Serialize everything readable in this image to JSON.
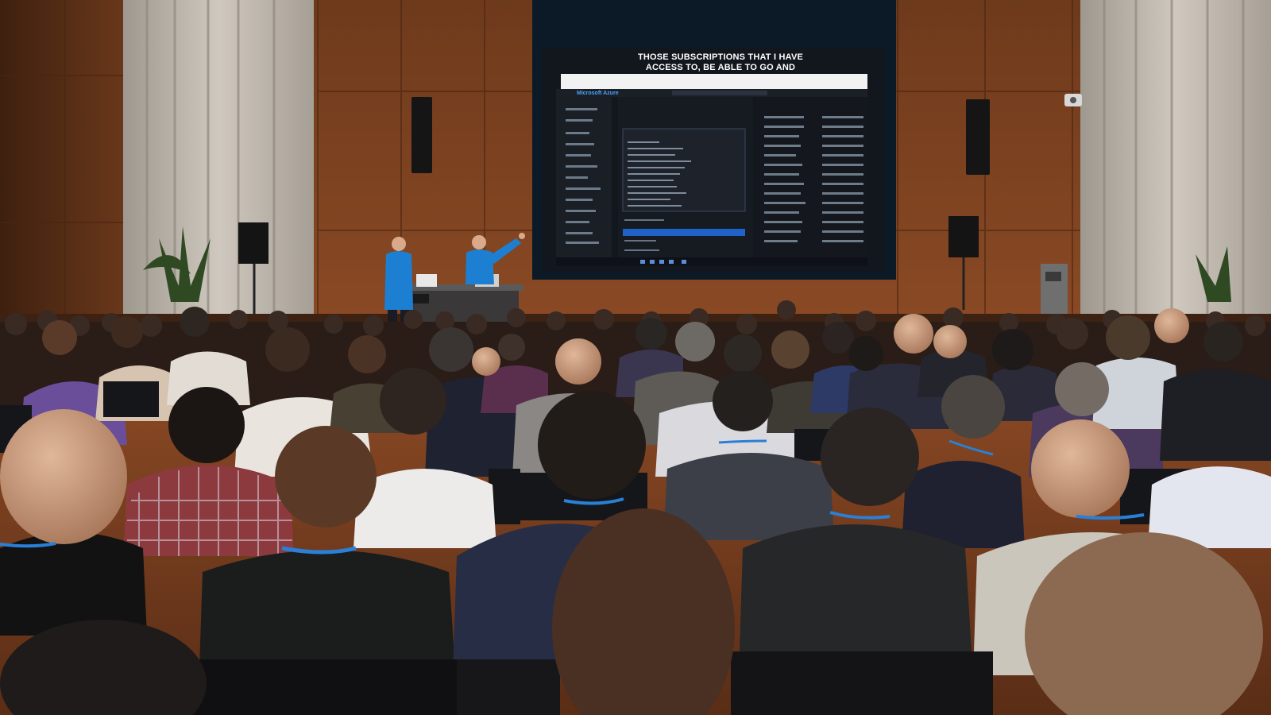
{
  "scene": {
    "description_free": true,
    "colors": {
      "wall_wood": "#8a4a24",
      "wall_wood_dark": "#5e3019",
      "curtain": "#bdb6ad",
      "screen_bg": "#12161d",
      "azure_blue": "#1e6fd0",
      "speaker_shirt": "#1d7fd1",
      "audience_dark": "#1c1c22",
      "lanyard": "#2a7fd6"
    }
  },
  "screen": {
    "caption_line_1": "THOSE SUBSCRIPTIONS THAT I HAVE",
    "caption_line_2": "ACCESS TO, BE ABLE TO GO AND",
    "app_brand": "Microsoft Azure"
  }
}
